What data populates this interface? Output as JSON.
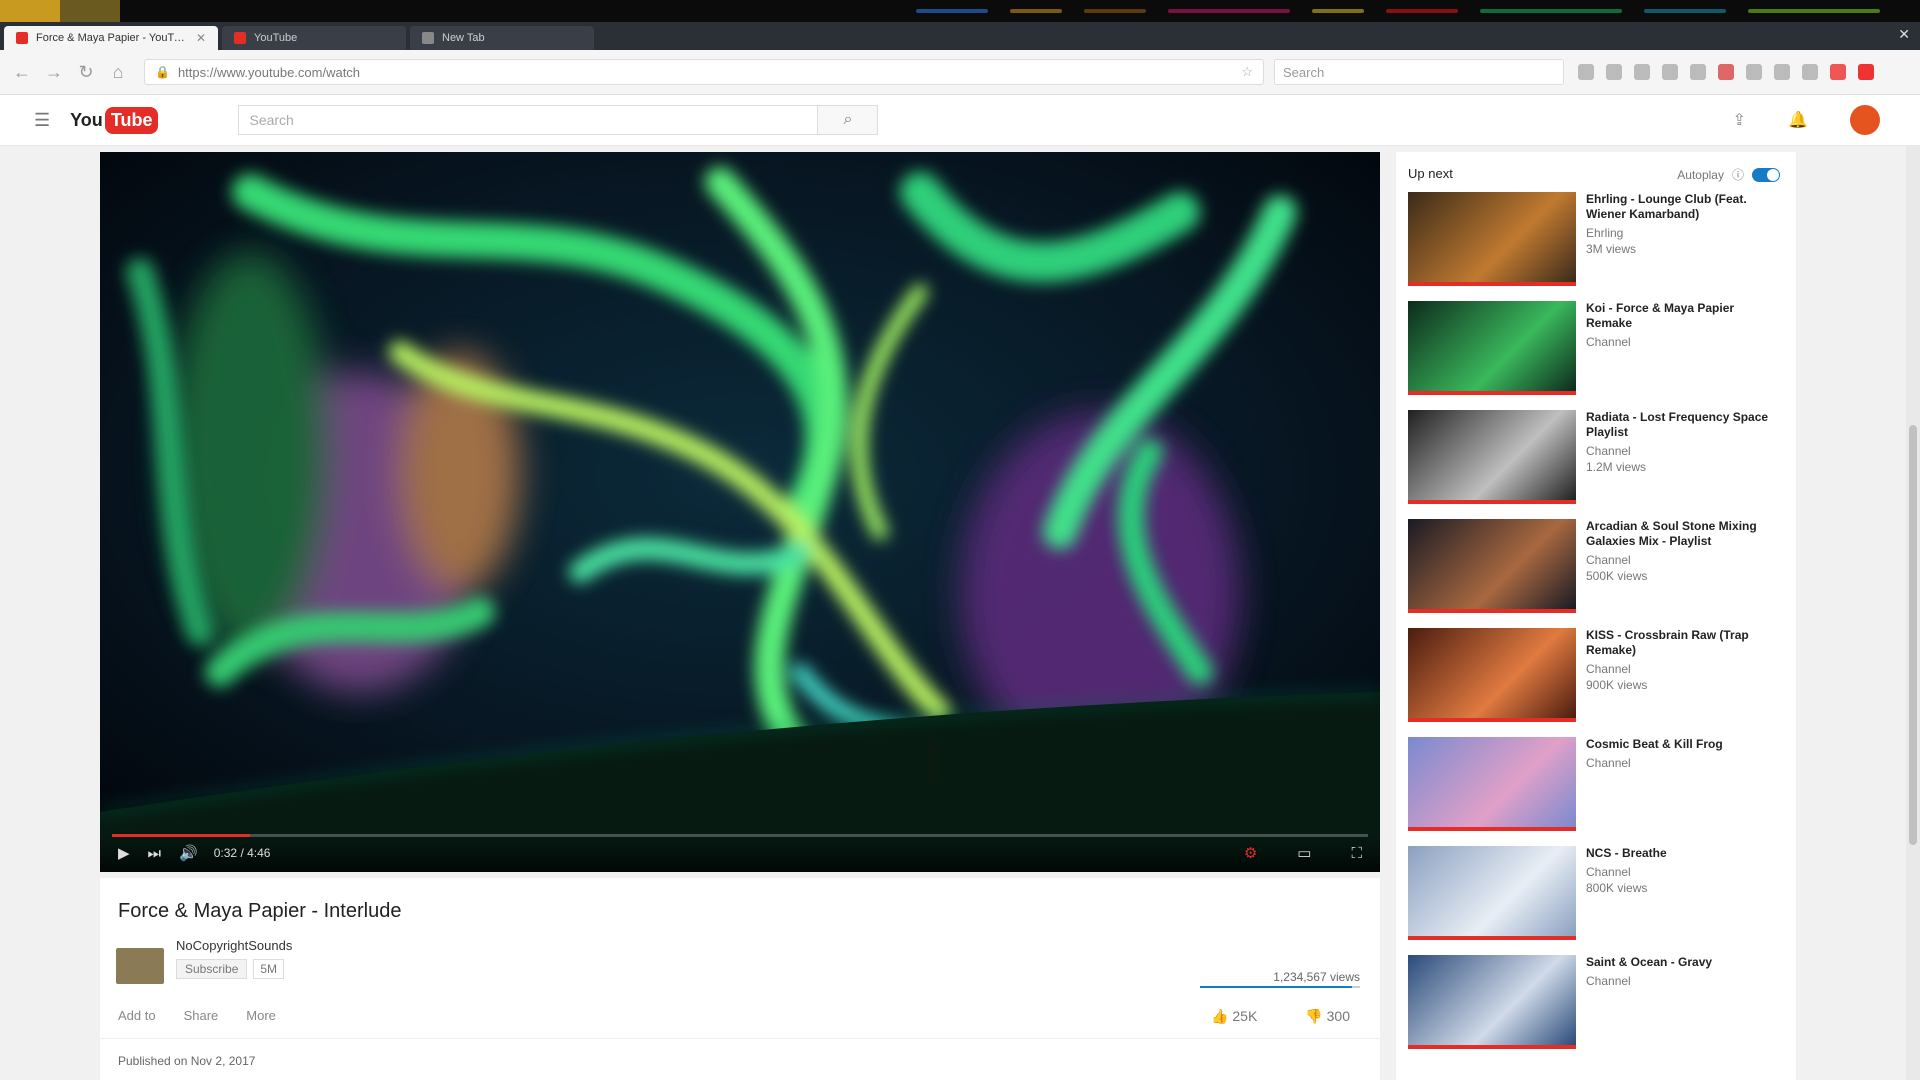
{
  "browser": {
    "tabs": [
      {
        "label": "Force & Maya Papier - YouTube"
      },
      {
        "label": "YouTube"
      },
      {
        "label": "New Tab"
      }
    ],
    "url": "https://www.youtube.com/watch",
    "search_placeholder": "Search"
  },
  "masthead": {
    "logo_prefix": "You",
    "logo_suffix": "Tube",
    "search_placeholder": "Search"
  },
  "player": {
    "progress_fraction": 0.11,
    "time": "0:32 / 4:46"
  },
  "video": {
    "title": "Force & Maya Papier - Interlude",
    "channel": "NoCopyrightSounds",
    "subscribe_label": "Subscribe",
    "subscriber_count": "5M",
    "views": "1,234,567 views",
    "like_fraction": 0.95,
    "actions": [
      "Add to",
      "Share",
      "More"
    ],
    "likes": "25K",
    "dislikes": "300",
    "published": "Published on Nov 2, 2017"
  },
  "sidebar": {
    "up_next": "Up next",
    "autoplay_label": "Autoplay",
    "recommendations": [
      {
        "title": "Ehrling - Lounge Club (Feat. Wiener Kamarband)",
        "channel": "Ehrling",
        "views": "3M views",
        "colors": [
          "#3a2a1a",
          "#c07a30"
        ]
      },
      {
        "title": "Koi - Force & Maya Papier Remake",
        "channel": "Channel",
        "views": "",
        "colors": [
          "#0d2a1c",
          "#3ab85c"
        ]
      },
      {
        "title": "Radiata - Lost Frequency Space Playlist",
        "channel": "Channel",
        "views": "1.2M views",
        "colors": [
          "#202020",
          "#bfbfbf"
        ]
      },
      {
        "title": "Arcadian & Soul Stone Mixing Galaxies Mix - Playlist",
        "channel": "Channel",
        "views": "500K views",
        "colors": [
          "#1a1a24",
          "#a86840"
        ]
      },
      {
        "title": "KISS - Crossbrain Raw (Trap Remake)",
        "channel": "Channel",
        "views": "900K views",
        "colors": [
          "#4a1c10",
          "#e07a40"
        ]
      },
      {
        "title": "Cosmic Beat & Kill Frog",
        "channel": "Channel",
        "views": "",
        "colors": [
          "#7a8ad0",
          "#e0a0c8"
        ]
      },
      {
        "title": "NCS - Breathe",
        "channel": "Channel",
        "views": "800K views",
        "colors": [
          "#8aa0c0",
          "#e8eef5"
        ]
      },
      {
        "title": "Saint & Ocean - Gravy",
        "channel": "Channel",
        "views": "",
        "colors": [
          "#2a4a7a",
          "#d0dae8"
        ]
      }
    ]
  },
  "colors": {
    "accent_red": "#e52d27",
    "accent_blue": "#167ac6"
  },
  "icons": [
    "menu-icon",
    "search-icon",
    "upload-icon",
    "bell-icon",
    "play-icon",
    "next-icon",
    "volume-icon",
    "settings-icon",
    "fullscreen-icon",
    "like-icon",
    "dislike-icon"
  ]
}
